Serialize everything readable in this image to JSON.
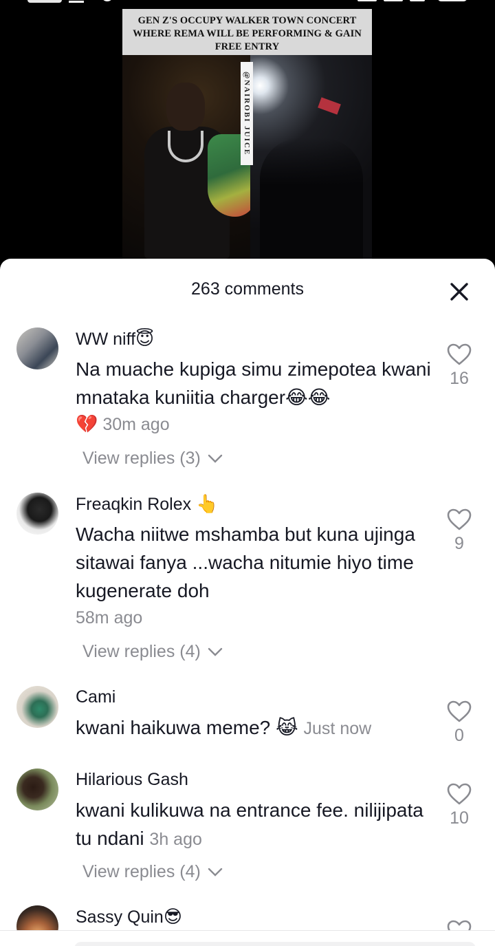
{
  "video": {
    "headline": "GEN Z'S OCCUPY WALKER TOWN CONCERT WHERE REMA WILL BE PERFORMING & GAIN FREE ENTRY",
    "watermark": "@NAIROBI JUICE"
  },
  "sheet": {
    "title": "263 comments"
  },
  "comments": [
    {
      "user": "WW niff",
      "user_emoji": "😇",
      "text": "Na muache kupiga simu zimepotea kwani mnataka kuniitia charger😂😂",
      "meta_emoji": "💔",
      "time": "30m ago",
      "likes": "16",
      "replies": "View replies (3)"
    },
    {
      "user": "Freaqkin Rolex",
      "user_emoji": "👆",
      "text": "Wacha niitwe mshamba but kuna ujinga sitawai fanya ...wacha nitumie hiyo time kugenerate doh",
      "time": "58m ago",
      "likes": "9",
      "replies": "View replies (4)"
    },
    {
      "user": "Cami",
      "user_emoji": "",
      "text": "kwani haikuwa meme? 😹",
      "time": "Just now",
      "likes": "0",
      "replies": ""
    },
    {
      "user": "Hilarious Gash",
      "user_emoji": "",
      "text": "kwani kulikuwa na entrance fee. nilijipata tu ndani",
      "time": "3h ago",
      "likes": "10",
      "replies": "View replies (4)"
    },
    {
      "user": "Sassy Quin",
      "user_emoji": "😎",
      "text": "",
      "time": "",
      "likes": "",
      "replies": ""
    }
  ],
  "colors": {
    "text_primary": "#161823",
    "text_secondary": "#8a8b91",
    "sheet_bg": "#ffffff",
    "video_bg": "#000000"
  },
  "icons": {
    "close": "close-icon",
    "like": "heart-outline-icon",
    "expand": "chevron-down-icon"
  }
}
